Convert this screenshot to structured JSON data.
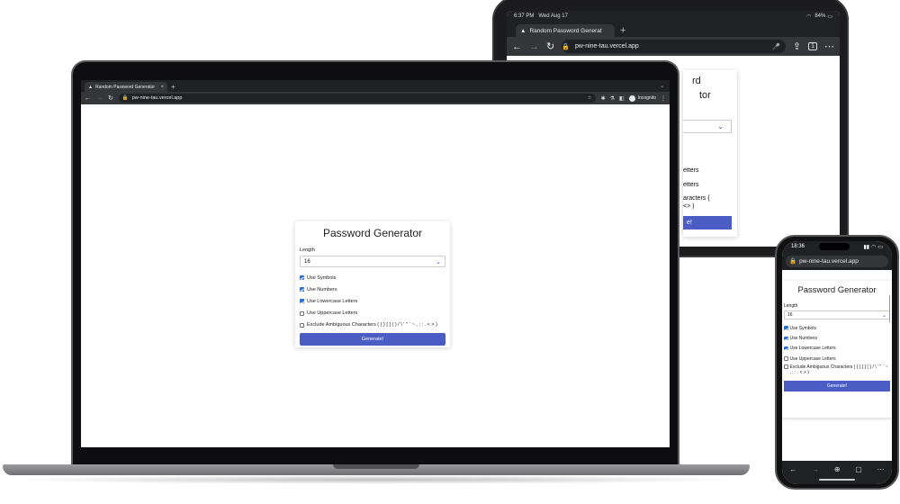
{
  "app": {
    "title": "Password Generator",
    "length_label": "Length",
    "length_value": "16",
    "options": [
      {
        "label": "Use Symbols",
        "checked": true
      },
      {
        "label": "Use Numbers",
        "checked": true
      },
      {
        "label": "Use Lowercase Letters",
        "checked": true
      },
      {
        "label": "Use Uppercase Letters",
        "checked": false
      },
      {
        "label": "Exclude Ambiguous Characters ( { } [ ] ( ) / \\ ' \" ` ~ , ; : . < > )",
        "checked": false
      }
    ],
    "generate_label": "Generate!",
    "accent_color": "#4b5cc4"
  },
  "laptop": {
    "tab_title": "Random Password Generator",
    "url": "pw-nine-tau.vercel.app",
    "incognito_label": "Incognito",
    "tab_close": "×",
    "new_tab": "+",
    "tab_menu": "⌄"
  },
  "tablet": {
    "time": "6:37 PM",
    "date": "Wed Aug 17",
    "battery": "84%",
    "tab_title": "Random Password Generat",
    "url": "pw-nine-tau.vercel.app",
    "tab_count": "1",
    "partial_title_1": "rd",
    "partial_title_2": "tor",
    "partial_opt_1": "etters",
    "partial_opt_2": "etters",
    "partial_opt_3": "aracters {",
    "partial_opt_4": "<> )",
    "partial_btn": "e!"
  },
  "phone": {
    "time": "18:36",
    "url": "pw-nine-tau.vercel.app",
    "exclude_label": "Exclude Ambiguous Characters ( { } [ ] ( ) / \\ ' \" ` ~ , ; : . < > )"
  }
}
